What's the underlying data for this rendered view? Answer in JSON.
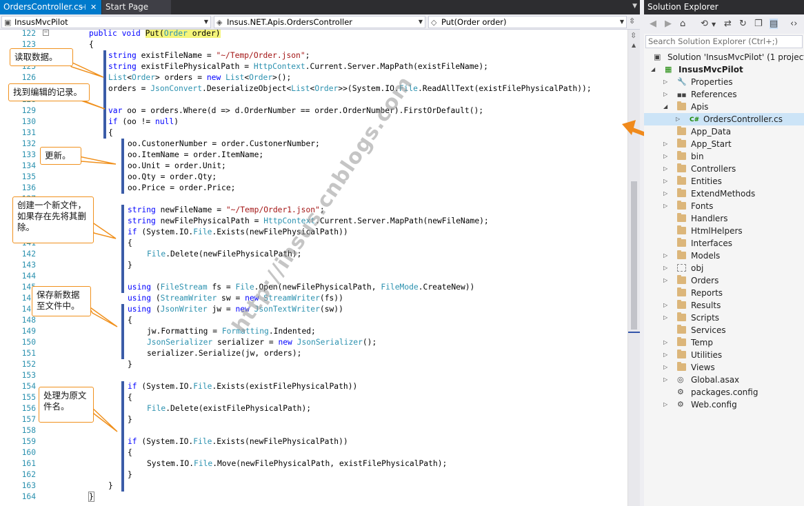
{
  "tabs": {
    "active": "OrdersController.cs",
    "inactive": "Start Page"
  },
  "nav": {
    "project": "InsusMvcPilot",
    "class": "Insus.NET.Apis.OrdersController",
    "member": "Put(Order order)"
  },
  "code_lines": [
    {
      "n": "122",
      "html": "<span class=\"kw\">public</span> <span class=\"kw\">void</span> <span class=\"hl\">Put(<span class=\"ty\">Order</span> order)</span>",
      "indent": 0
    },
    {
      "n": "123",
      "html": "{",
      "indent": 0
    },
    {
      "n": "124",
      "html": "<span class=\"kw\">string</span> existFileName = <span class=\"st\">\"~/Temp/Order.json\"</span>;",
      "indent": 1
    },
    {
      "n": "125",
      "html": "<span class=\"kw\">string</span> existFilePhysicalPath = <span class=\"ty\">HttpContext</span>.Current.Server.MapPath(existFileName);",
      "indent": 1
    },
    {
      "n": "126",
      "html": "<span class=\"ty\">List</span>&lt;<span class=\"ty\">Order</span>&gt; orders = <span class=\"kw\">new</span> <span class=\"ty\">List</span>&lt;<span class=\"ty\">Order</span>&gt;();",
      "indent": 1
    },
    {
      "n": "127",
      "html": "orders = <span class=\"ty\">JsonConvert</span>.DeserializeObject&lt;<span class=\"ty\">List</span>&lt;<span class=\"ty\">Order</span>&gt;&gt;(System.IO.<span class=\"ty\">File</span>.ReadAllText(existFilePhysicalPath));",
      "indent": 1
    },
    {
      "n": "128",
      "html": "",
      "indent": 1
    },
    {
      "n": "129",
      "html": "<span class=\"kw\">var</span> oo = orders.Where(d =&gt; d.OrderNumber == order.OrderNumber).FirstOrDefault();",
      "indent": 1
    },
    {
      "n": "130",
      "html": "<span class=\"kw\">if</span> (oo != <span class=\"kw\">null</span>)",
      "indent": 1
    },
    {
      "n": "131",
      "html": "{",
      "indent": 1
    },
    {
      "n": "132",
      "html": "oo.CustonerNumber = order.CustonerNumber;",
      "indent": 2
    },
    {
      "n": "133",
      "html": "oo.ItemName = order.ItemName;",
      "indent": 2
    },
    {
      "n": "134",
      "html": "oo.Unit = order.Unit;",
      "indent": 2
    },
    {
      "n": "135",
      "html": "oo.Qty = order.Qty;",
      "indent": 2
    },
    {
      "n": "136",
      "html": "oo.Price = order.Price;",
      "indent": 2
    },
    {
      "n": "137",
      "html": "",
      "indent": 2
    },
    {
      "n": "138",
      "html": "<span class=\"kw\">string</span> newFileName = <span class=\"st\">\"~/Temp/Order1.json\"</span>;",
      "indent": 2
    },
    {
      "n": "139",
      "html": "<span class=\"kw\">string</span> newFilePhysicalPath = <span class=\"ty\">HttpContext</span>.Current.Server.MapPath(newFileName);",
      "indent": 2
    },
    {
      "n": "140",
      "html": "<span class=\"kw\">if</span> (System.IO.<span class=\"ty\">File</span>.Exists(newFilePhysicalPath))",
      "indent": 2
    },
    {
      "n": "141",
      "html": "{",
      "indent": 2
    },
    {
      "n": "142",
      "html": "<span class=\"ty\">File</span>.Delete(newFilePhysicalPath);",
      "indent": 3
    },
    {
      "n": "143",
      "html": "}",
      "indent": 2
    },
    {
      "n": "144",
      "html": "",
      "indent": 2
    },
    {
      "n": "145",
      "html": "<span class=\"kw\">using</span> (<span class=\"ty\">FileStream</span> fs = <span class=\"ty\">File</span>.Open(newFilePhysicalPath, <span class=\"ty\">FileMode</span>.CreateNew))",
      "indent": 2
    },
    {
      "n": "146",
      "html": "<span class=\"kw\">using</span> (<span class=\"ty\">StreamWriter</span> sw = <span class=\"kw\">new</span> <span class=\"ty\">StreamWriter</span>(fs))",
      "indent": 2
    },
    {
      "n": "147",
      "html": "<span class=\"kw\">using</span> (<span class=\"ty\">JsonWriter</span> jw = <span class=\"kw\">new</span> <span class=\"ty\">JsonTextWriter</span>(sw))",
      "indent": 2
    },
    {
      "n": "148",
      "html": "{",
      "indent": 2
    },
    {
      "n": "149",
      "html": "jw.Formatting = <span class=\"ty\">Formatting</span>.Indented;",
      "indent": 3
    },
    {
      "n": "150",
      "html": "<span class=\"ty\">JsonSerializer</span> serializer = <span class=\"kw\">new</span> <span class=\"ty\">JsonSerializer</span>();",
      "indent": 3
    },
    {
      "n": "151",
      "html": "serializer.Serialize(jw, orders);",
      "indent": 3
    },
    {
      "n": "152",
      "html": "}",
      "indent": 2
    },
    {
      "n": "153",
      "html": "",
      "indent": 2
    },
    {
      "n": "154",
      "html": "<span class=\"kw\">if</span> (System.IO.<span class=\"ty\">File</span>.Exists(existFilePhysicalPath))",
      "indent": 2
    },
    {
      "n": "155",
      "html": "{",
      "indent": 2
    },
    {
      "n": "156",
      "html": "<span class=\"ty\">File</span>.Delete(existFilePhysicalPath);",
      "indent": 3
    },
    {
      "n": "157",
      "html": "}",
      "indent": 2
    },
    {
      "n": "158",
      "html": "",
      "indent": 2
    },
    {
      "n": "159",
      "html": "<span class=\"kw\">if</span> (System.IO.<span class=\"ty\">File</span>.Exists(newFilePhysicalPath))",
      "indent": 2
    },
    {
      "n": "160",
      "html": "{",
      "indent": 2
    },
    {
      "n": "161",
      "html": "System.IO.<span class=\"ty\">File</span>.Move(newFilePhysicalPath, existFilePhysicalPath);",
      "indent": 3
    },
    {
      "n": "162",
      "html": "}",
      "indent": 2
    },
    {
      "n": "163",
      "html": "}",
      "indent": 1
    },
    {
      "n": "164",
      "html": "<span class=\"brace-hl\">}</span>",
      "indent": 0
    }
  ],
  "callouts": {
    "read": "读取数据。",
    "find": "找到编辑的记录。",
    "update": "更新。",
    "create": "创建一个新文件，如果存在先将其删除。",
    "save": "保存新数据至文件中。",
    "rename": "处理为原文件名。"
  },
  "watermark": "http://insus.cnblogs.com",
  "solution": {
    "title": "Solution Explorer",
    "search_placeholder": "Search Solution Explorer (Ctrl+;)",
    "nodes": [
      {
        "label": "Solution 'InsusMvcPilot' (1 project)",
        "level": 0,
        "icon": "solution",
        "exp": ""
      },
      {
        "label": "InsusMvcPilot",
        "level": 1,
        "icon": "project",
        "exp": "open",
        "bold": true
      },
      {
        "label": "Properties",
        "level": 2,
        "icon": "wrench",
        "exp": "closed"
      },
      {
        "label": "References",
        "level": 2,
        "icon": "references",
        "exp": "closed"
      },
      {
        "label": "Apis",
        "level": 2,
        "icon": "folder",
        "exp": "open"
      },
      {
        "label": "OrdersController.cs",
        "level": 3,
        "icon": "csharp",
        "exp": "closed",
        "selected": true
      },
      {
        "label": "App_Data",
        "level": 2,
        "icon": "folder",
        "exp": ""
      },
      {
        "label": "App_Start",
        "level": 2,
        "icon": "folder",
        "exp": "closed"
      },
      {
        "label": "bin",
        "level": 2,
        "icon": "folder",
        "exp": "closed"
      },
      {
        "label": "Controllers",
        "level": 2,
        "icon": "folder",
        "exp": "closed"
      },
      {
        "label": "Entities",
        "level": 2,
        "icon": "folder",
        "exp": "closed"
      },
      {
        "label": "ExtendMethods",
        "level": 2,
        "icon": "folder",
        "exp": "closed"
      },
      {
        "label": "Fonts",
        "level": 2,
        "icon": "folder",
        "exp": "closed"
      },
      {
        "label": "Handlers",
        "level": 2,
        "icon": "folder",
        "exp": ""
      },
      {
        "label": "HtmlHelpers",
        "level": 2,
        "icon": "folder",
        "exp": ""
      },
      {
        "label": "Interfaces",
        "level": 2,
        "icon": "folder",
        "exp": ""
      },
      {
        "label": "Models",
        "level": 2,
        "icon": "folder",
        "exp": "closed"
      },
      {
        "label": "obj",
        "level": 2,
        "icon": "folder-dotted",
        "exp": "closed"
      },
      {
        "label": "Orders",
        "level": 2,
        "icon": "folder",
        "exp": "closed"
      },
      {
        "label": "Reports",
        "level": 2,
        "icon": "folder",
        "exp": ""
      },
      {
        "label": "Results",
        "level": 2,
        "icon": "folder",
        "exp": "closed"
      },
      {
        "label": "Scripts",
        "level": 2,
        "icon": "folder",
        "exp": "closed"
      },
      {
        "label": "Services",
        "level": 2,
        "icon": "folder",
        "exp": ""
      },
      {
        "label": "Temp",
        "level": 2,
        "icon": "folder",
        "exp": "closed"
      },
      {
        "label": "Utilities",
        "level": 2,
        "icon": "folder",
        "exp": "closed"
      },
      {
        "label": "Views",
        "level": 2,
        "icon": "folder",
        "exp": "closed"
      },
      {
        "label": "Global.asax",
        "level": 2,
        "icon": "file-globe",
        "exp": "closed"
      },
      {
        "label": "packages.config",
        "level": 2,
        "icon": "file-config",
        "exp": ""
      },
      {
        "label": "Web.config",
        "level": 2,
        "icon": "file-config",
        "exp": "closed"
      }
    ]
  },
  "colors": {
    "accent": "#007acc",
    "callout_border": "#f0901c",
    "arrow": "#f08a1c",
    "change_bar": "#3b5ca8"
  }
}
